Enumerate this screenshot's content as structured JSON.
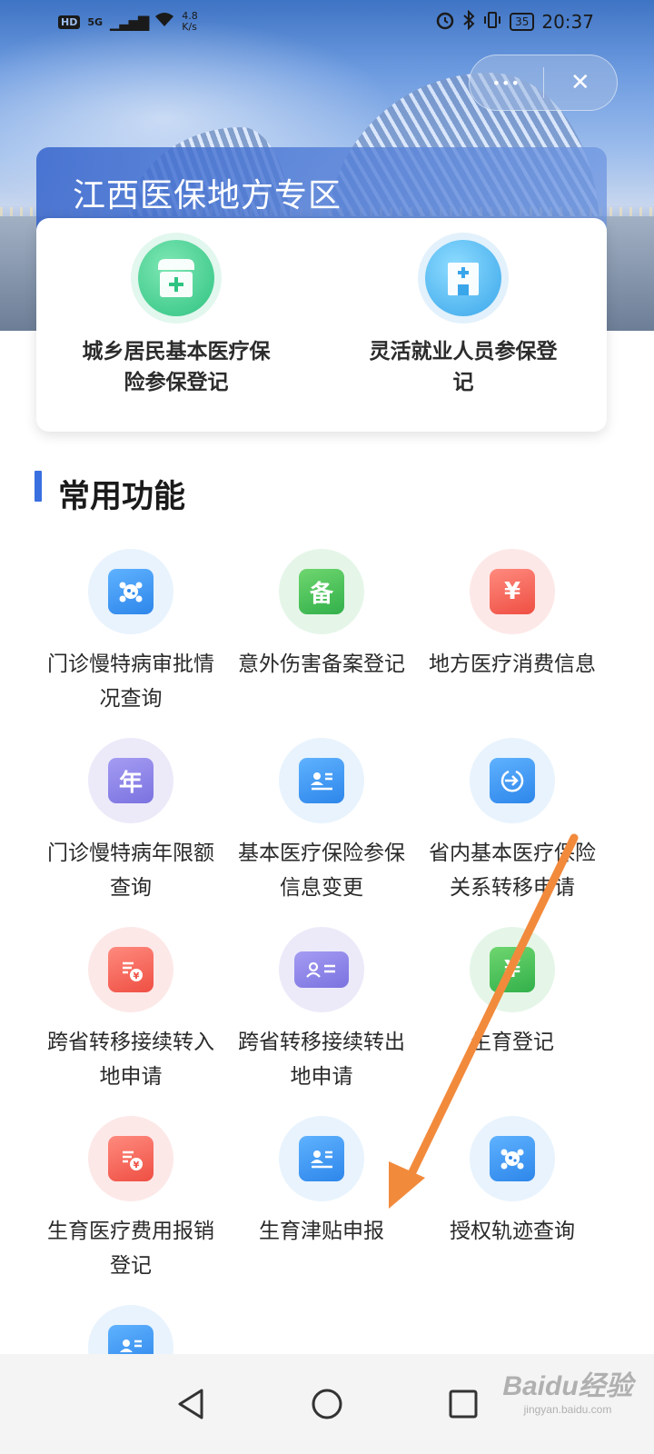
{
  "status_bar": {
    "network": "HD",
    "signal": "5G",
    "speed_value": "4.8",
    "speed_unit": "K/s",
    "battery": "35",
    "time": "20:37"
  },
  "capsule": {
    "more_label": "•••",
    "close_label": "✕"
  },
  "zone": {
    "title": "江西医保地方专区",
    "items": [
      {
        "label": "城乡居民基本医疗保险参保登记",
        "icon": "clinic-icon"
      },
      {
        "label": "灵活就业人员参保登记",
        "icon": "hospital-icon"
      }
    ]
  },
  "section": {
    "title": "常用功能"
  },
  "functions": [
    {
      "label": "门诊慢特病审批情况查询",
      "icon": "virus-icon"
    },
    {
      "label": "意外伤害备案登记",
      "icon": "record-edit-icon",
      "glyph": "备"
    },
    {
      "label": "地方医疗消费信息",
      "icon": "yuan-receipt-icon",
      "glyph": "¥"
    },
    {
      "label": "门诊慢特病年限额查询",
      "icon": "year-search-icon",
      "glyph": "年"
    },
    {
      "label": "基本医疗保险参保信息变更",
      "icon": "id-card-icon"
    },
    {
      "label": "省内基本医疗保险关系转移申请",
      "icon": "transfer-in-icon"
    },
    {
      "label": "跨省转移接续转入地申请",
      "icon": "bill-yuan-icon"
    },
    {
      "label": "跨省转移接续转出地申请",
      "icon": "contact-card-icon"
    },
    {
      "label": "生育登记",
      "icon": "yuan-note-icon",
      "glyph": "¥"
    },
    {
      "label": "生育医疗费用报销登记",
      "icon": "bill-yuan-icon"
    },
    {
      "label": "生育津贴申报",
      "icon": "id-card-icon"
    },
    {
      "label": "授权轨迹查询",
      "icon": "virus-icon"
    },
    {
      "label": "",
      "icon": "id-card-icon"
    }
  ],
  "watermark": {
    "main": "Baidu经验",
    "sub": "jingyan.baidu.com"
  },
  "colors": {
    "accent": "#3a6fe0",
    "arrow": "#f28a3c"
  }
}
